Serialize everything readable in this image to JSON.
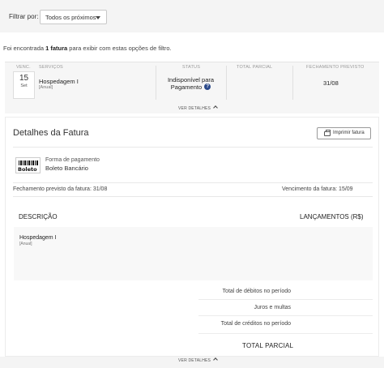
{
  "filter": {
    "label": "Filtrar por:",
    "selected": "Todos os próximos"
  },
  "result": {
    "prefix": "Foi encontrada ",
    "count": "1 fatura",
    "suffix": " para exibir com estas opções de filtro."
  },
  "invoice": {
    "headers": {
      "venc": "VENC.",
      "servicos": "SERVIÇOS",
      "status": "STATUS",
      "total_parcial": "TOTAL PARCIAL",
      "fechamento": "FECHAMENTO PREVISTO"
    },
    "day": "15",
    "month": "Set",
    "service_name": "Hospedagem I",
    "service_period": "[Anual]",
    "status": "Indisponível para Pagamento",
    "fechamento": "31/08",
    "ver_detalhes": "VER DETALHES"
  },
  "details": {
    "title": "Detalhes da Fatura",
    "print_label": "Imprimir fatura",
    "boleto_word": "Boleto",
    "pay_label": "Forma de pagamento",
    "pay_value": "Boleto Bancário",
    "fechamento_previsto": "Fechamento previsto da fatura: 31/08",
    "vencimento": "Vencimento da fatura: 15/09",
    "col_descricao": "DESCRIÇÃO",
    "col_lancamentos": "LANÇAMENTOS (R$)",
    "item_name": "Hospedagem I",
    "item_period": "[Anual]",
    "total_debitos": "Total de débitos no período",
    "juros": "Juros e multas",
    "total_creditos": "Total de créditos no período",
    "total_parcial": "TOTAL PARCIAL"
  },
  "bottom": {
    "ver_detalhes": "VER DETALHES"
  }
}
